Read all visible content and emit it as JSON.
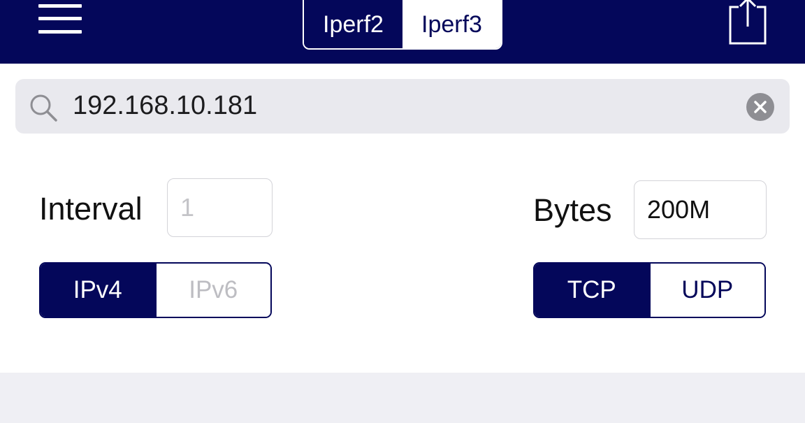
{
  "header": {
    "tabs": [
      {
        "label": "Iperf2",
        "selected": false
      },
      {
        "label": "Iperf3",
        "selected": true
      }
    ]
  },
  "search": {
    "value": "192.168.10.181"
  },
  "form": {
    "interval_label": "Interval",
    "interval_placeholder": "1",
    "bytes_label": "Bytes",
    "bytes_value": "200M",
    "ip_options": [
      {
        "label": "IPv4",
        "selected": true
      },
      {
        "label": "IPv6",
        "selected": false
      }
    ],
    "protocol_options": [
      {
        "label": "TCP",
        "selected": true
      },
      {
        "label": "UDP",
        "selected": false
      }
    ]
  },
  "colors": {
    "accent": "#04075a",
    "search_background": "#e9e9ee",
    "bottom_background": "#efeff4"
  },
  "icons": {
    "menu": "hamburger-menu-icon",
    "share": "share-icon",
    "search": "search-icon",
    "clear": "clear-icon"
  }
}
